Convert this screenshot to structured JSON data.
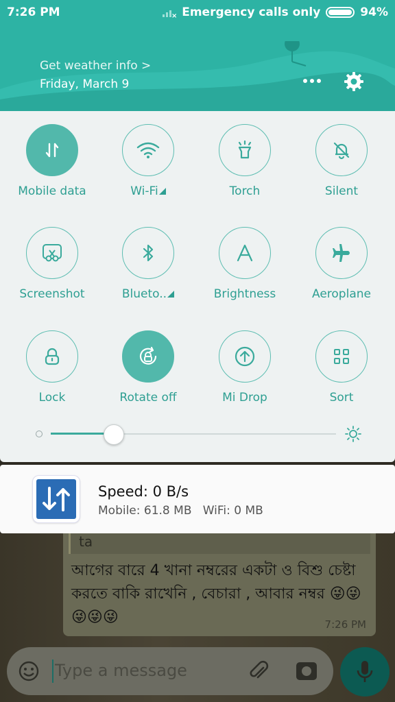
{
  "status_bar": {
    "time": "7:26 PM",
    "carrier": "Emergency calls only",
    "battery": "94%"
  },
  "header": {
    "weather": "Get weather info >",
    "date": "Friday, March 9"
  },
  "tiles": [
    {
      "label": "Mobile data",
      "icon": "mobile-data-icon",
      "active": true
    },
    {
      "label": "Wi-Fi",
      "icon": "wifi-icon",
      "active": false,
      "expandable": true
    },
    {
      "label": "Torch",
      "icon": "torch-icon",
      "active": false
    },
    {
      "label": "Silent",
      "icon": "silent-bell-icon",
      "active": false
    },
    {
      "label": "Screenshot",
      "icon": "scissors-icon",
      "active": false
    },
    {
      "label": "Blueto..",
      "icon": "bluetooth-icon",
      "active": false,
      "expandable": true
    },
    {
      "label": "Brightness",
      "icon": "brightness-a-icon",
      "active": false
    },
    {
      "label": "Aeroplane",
      "icon": "airplane-icon",
      "active": false
    },
    {
      "label": "Lock",
      "icon": "lock-icon",
      "active": false
    },
    {
      "label": "Rotate off",
      "icon": "rotate-lock-icon",
      "active": true
    },
    {
      "label": "Mi Drop",
      "icon": "upload-icon",
      "active": false
    },
    {
      "label": "Sort",
      "icon": "grid-icon",
      "active": false
    }
  ],
  "brightness": {
    "level": 0.22
  },
  "notification": {
    "title": "Speed: 0 B/s",
    "detail": "Mobile: 61.8 MB   WiFi: 0 MB"
  },
  "chat": {
    "quote": "ta",
    "message": "আগের বারে 4 খানা নম্বরের একটা ও বিশু চেষ্টা করতে বাকি রাখেনি , বেচারা , আবার নম্বর 😜😜😜😜😜",
    "time": "7:26 PM",
    "input_placeholder": "Type a message"
  },
  "colors": {
    "accent": "#2db3a4",
    "tile_text": "#2e9f92",
    "panel_bg": "#eef2f2"
  }
}
